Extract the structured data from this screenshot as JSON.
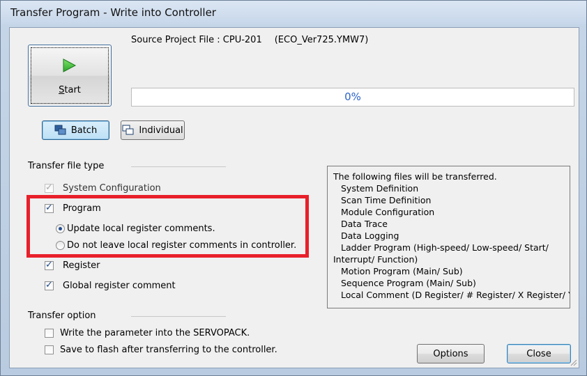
{
  "window": {
    "title": "Transfer Program - Write into Controller"
  },
  "header": {
    "start_label_letter": "S",
    "start_label_rest": "tart",
    "source_prefix": "Source Project File : CPU-201",
    "source_file": "(ECO_Ver725.YMW7)",
    "progress_text": "0%",
    "progress_value": 0
  },
  "modes": {
    "batch_label": "Batch",
    "individual_label": "Individual",
    "active": "batch"
  },
  "transfer_type": {
    "group_label": "Transfer file type",
    "system_configuration": {
      "label": "System Configuration",
      "checked": true,
      "disabled": true
    },
    "program": {
      "label": "Program",
      "checked": true
    },
    "radio_update": {
      "label": "Update local register comments.",
      "selected": true
    },
    "radio_do_not_leave": {
      "label": "Do not leave local register comments in controller.",
      "selected": false
    },
    "register": {
      "label": "Register",
      "checked": true
    },
    "global_comment": {
      "label": "Global register comment",
      "checked": true
    }
  },
  "transfer_option": {
    "group_label": "Transfer option",
    "write_servopack": {
      "label": "Write the parameter into the SERVOPACK.",
      "checked": false
    },
    "save_flash": {
      "label": "Save to flash after transferring to the controller.",
      "checked": false
    }
  },
  "info": {
    "heading": "The following files will be transferred.",
    "lines": [
      "System Definition",
      "Scan Time Definition",
      "Module Configuration",
      "Data Trace",
      "Data Logging",
      "Ladder Program (High-speed/ Low-speed/ Start/",
      "Interrupt/ Function)",
      "Motion Program (Main/ Sub)",
      "Sequence Program (Main/ Sub)",
      "Local Comment (D Register/ # Register/ X Register/ Y"
    ]
  },
  "buttons": {
    "options_label": "Options",
    "close_label": "Close"
  },
  "colors": {
    "highlight": "#e8202a",
    "progress_text": "#2d63c8",
    "active_mode": "#bde0f6"
  }
}
